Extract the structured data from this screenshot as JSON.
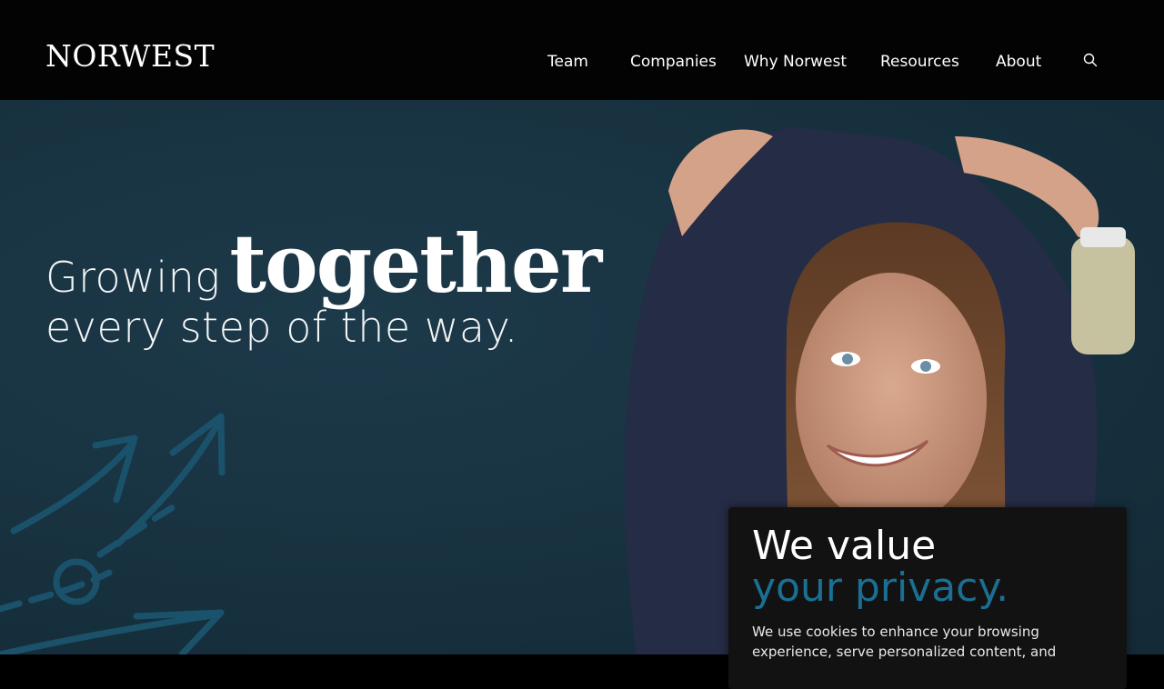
{
  "header": {
    "logo_text": "NORWEST",
    "nav": [
      {
        "label": "Team"
      },
      {
        "label": "Companies"
      },
      {
        "label": "Why Norwest"
      },
      {
        "label": "Resources"
      },
      {
        "label": "About"
      }
    ],
    "search_icon": "search-icon"
  },
  "hero": {
    "line1_light": "Growing",
    "line1_bold": "together",
    "line2": "every step of the way."
  },
  "cookie_banner": {
    "title_line1": "We value",
    "title_line2": "your privacy.",
    "body": "We use cookies to enhance your browsing experience, serve personalized content, and"
  },
  "colors": {
    "header_bg": "#030303",
    "hero_bg": "#17313f",
    "accent_blue": "#1a6f92",
    "banner_bg": "#121212"
  }
}
